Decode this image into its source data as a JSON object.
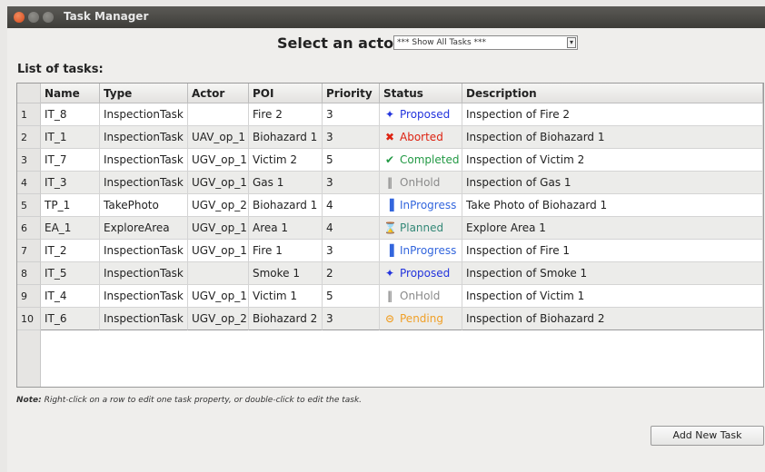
{
  "window": {
    "title": "Task Manager"
  },
  "actor_filter": {
    "label": "Select an actor",
    "selected": "*** Show All Tasks ***"
  },
  "list_title": "List of tasks:",
  "columns": [
    "Name",
    "Type",
    "Actor",
    "POI",
    "Priority",
    "Status",
    "Description"
  ],
  "rows": [
    {
      "num": "1",
      "name": "IT_8",
      "type": "InspectionTask",
      "actor": "",
      "poi": "Fire 2",
      "priority": "3",
      "status": "Proposed",
      "status_icon": "lightbulb-icon",
      "description": "Inspection of Fire 2"
    },
    {
      "num": "2",
      "name": "IT_1",
      "type": "InspectionTask",
      "actor": "UAV_op_1",
      "poi": "Biohazard 1",
      "priority": "3",
      "status": "Aborted",
      "status_icon": "x-icon",
      "description": "Inspection of Biohazard 1"
    },
    {
      "num": "3",
      "name": "IT_7",
      "type": "InspectionTask",
      "actor": "UGV_op_1",
      "poi": "Victim 2",
      "priority": "5",
      "status": "Completed",
      "status_icon": "checkmark-icon",
      "description": "Inspection of Victim 2"
    },
    {
      "num": "4",
      "name": "IT_3",
      "type": "InspectionTask",
      "actor": "UGV_op_1",
      "poi": "Gas 1",
      "priority": "3",
      "status": "OnHold",
      "status_icon": "pause-icon",
      "description": "Inspection of Gas 1"
    },
    {
      "num": "5",
      "name": "TP_1",
      "type": "TakePhoto",
      "actor": "UGV_op_2",
      "poi": "Biohazard 1",
      "priority": "4",
      "status": "InProgress",
      "status_icon": "bars-icon",
      "description": "Take Photo of Biohazard 1"
    },
    {
      "num": "6",
      "name": "EA_1",
      "type": "ExploreArea",
      "actor": "UGV_op_1",
      "poi": "Area 1",
      "priority": "4",
      "status": "Planned",
      "status_icon": "hourglass-icon",
      "description": "Explore Area 1"
    },
    {
      "num": "7",
      "name": "IT_2",
      "type": "InspectionTask",
      "actor": "UGV_op_1",
      "poi": "Fire 1",
      "priority": "3",
      "status": "InProgress",
      "status_icon": "bars-icon",
      "description": "Inspection of Fire 1"
    },
    {
      "num": "8",
      "name": "IT_5",
      "type": "InspectionTask",
      "actor": "",
      "poi": "Smoke 1",
      "priority": "2",
      "status": "Proposed",
      "status_icon": "lightbulb-icon",
      "description": "Inspection of Smoke 1"
    },
    {
      "num": "9",
      "name": "IT_4",
      "type": "InspectionTask",
      "actor": "UGV_op_1",
      "poi": "Victim 1",
      "priority": "5",
      "status": "OnHold",
      "status_icon": "pause-icon",
      "description": "Inspection of Victim 1"
    },
    {
      "num": "10",
      "name": "IT_6",
      "type": "InspectionTask",
      "actor": "UGV_op_2",
      "poi": "Biohazard 2",
      "priority": "3",
      "status": "Pending",
      "status_icon": "pending-icon",
      "description": "Inspection of Biohazard 2"
    }
  ],
  "status_colors": {
    "Proposed": "#2233dd",
    "Aborted": "#dd2211",
    "Completed": "#229944",
    "OnHold": "#8a8a8a",
    "InProgress": "#3366dd",
    "Planned": "#338877",
    "Pending": "#f0a028"
  },
  "note": {
    "prefix": "Note:",
    "text": " Right-click on a row to edit one task property, or double-click to edit the task."
  },
  "add_button": "Add New Task"
}
